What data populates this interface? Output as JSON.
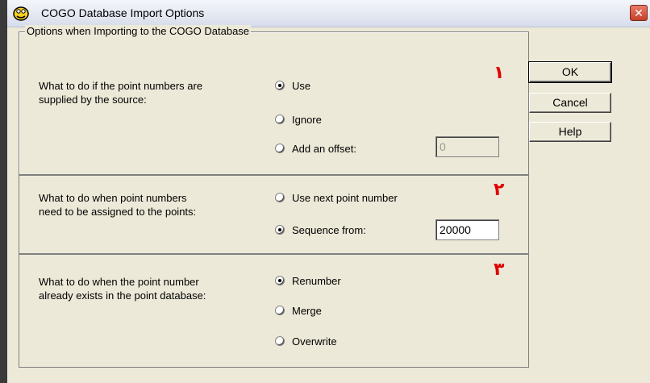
{
  "window": {
    "title": "COGO Database Import Options",
    "close_symbol": "✕",
    "icon": "cogo-app-icon"
  },
  "group": {
    "title": "Options when Importing to the COGO Database"
  },
  "sections": [
    {
      "marker": "١",
      "question_line1": "What to do if the point numbers are",
      "question_line2": "supplied by the source:",
      "options": [
        "Use",
        "Ignore",
        "Add an offset:"
      ],
      "selected": "Use",
      "offset_value": "0"
    },
    {
      "marker": "٢",
      "question_line1": "What to do when point numbers",
      "question_line2": "need to be assigned to the points:",
      "options": [
        "Use next point number",
        "Sequence from:"
      ],
      "selected": "Sequence from:",
      "sequence_value": "20000"
    },
    {
      "marker": "٣",
      "question_line1": "What to do when the point number",
      "question_line2": "already exists in the point database:",
      "options": [
        "Renumber",
        "Merge",
        "Overwrite"
      ],
      "selected": "Renumber"
    }
  ],
  "buttons": {
    "ok": "OK",
    "cancel": "Cancel",
    "help": "Help"
  },
  "colors": {
    "dialog_bg": "#ece9d8",
    "marker": "#e00000",
    "close_button": "#c4412b"
  }
}
